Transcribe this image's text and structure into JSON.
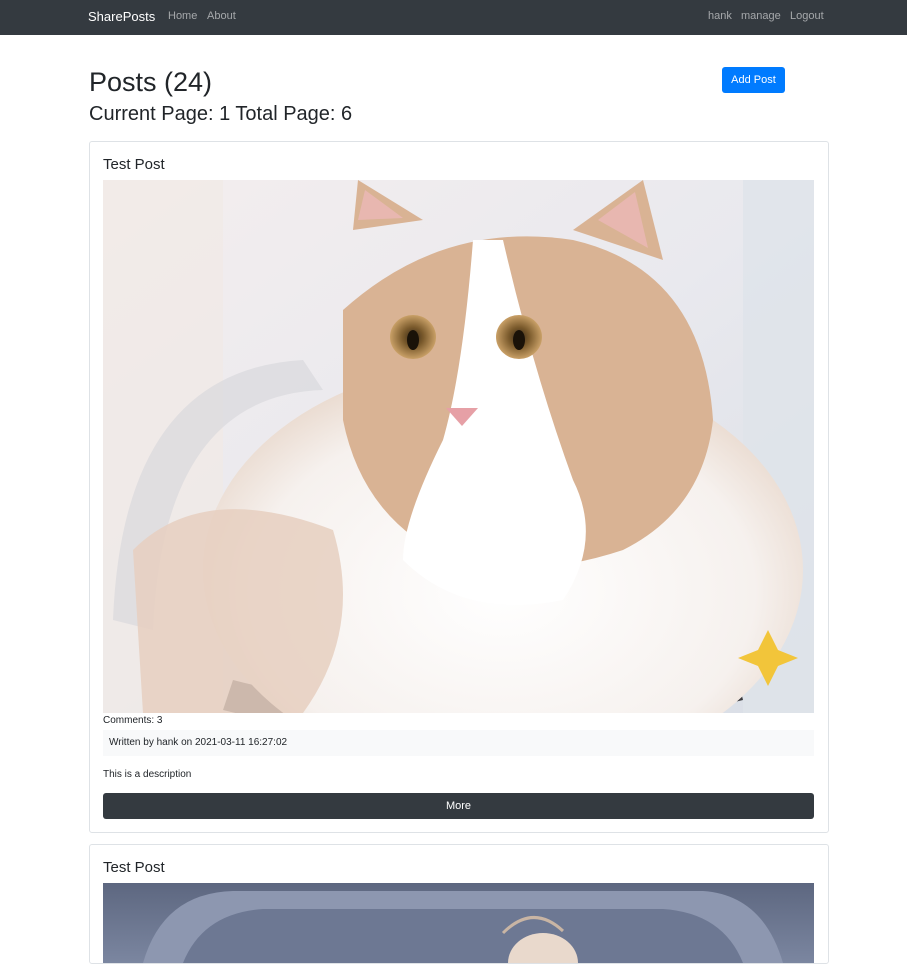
{
  "navbar": {
    "brand": "SharePosts",
    "links": [
      "Home",
      "About"
    ],
    "user": "hank",
    "manage": "manage",
    "logout": "Logout"
  },
  "header": {
    "title": "Posts (24)",
    "pagination": "Current Page: 1 Total Page: 6",
    "add_button": "Add Post"
  },
  "posts": [
    {
      "title": "Test Post",
      "comments": "Comments: 3",
      "meta": "Written by hank on 2021-03-11 16:27:02",
      "description": "This is a description",
      "more": "More"
    },
    {
      "title": "Test Post"
    }
  ],
  "colors": {
    "navbar_bg": "#343a40",
    "primary": "#007bff",
    "dark_button": "#343a40"
  }
}
